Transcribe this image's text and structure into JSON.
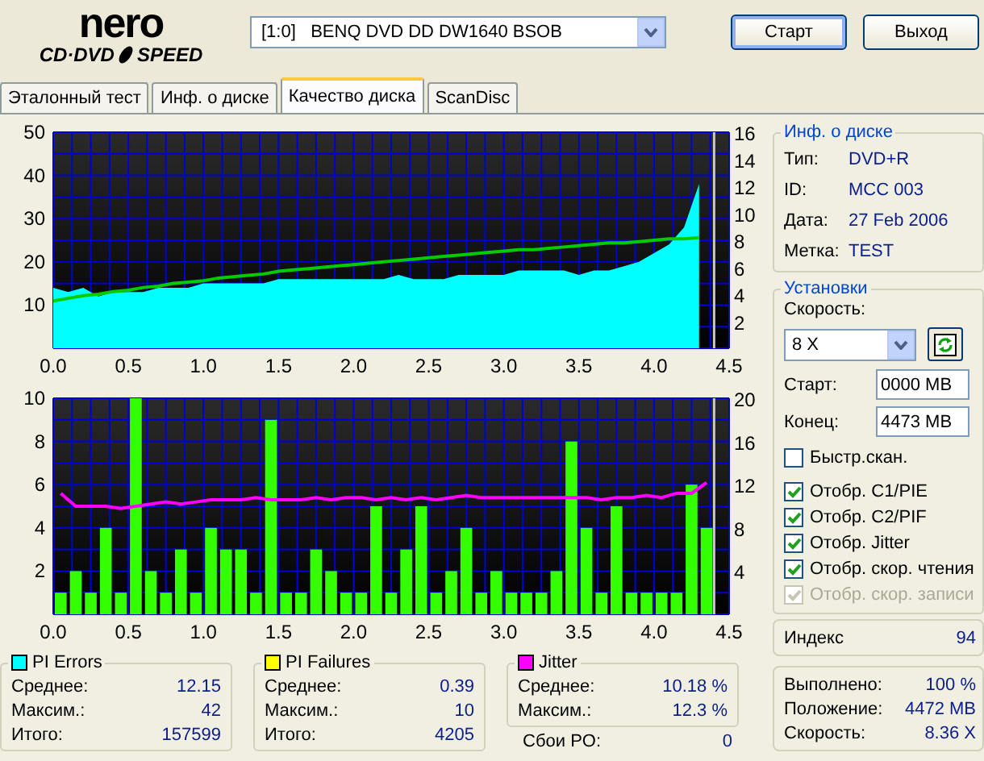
{
  "logo": {
    "top": "nero",
    "left": "CD·DVD",
    "right": "SPEED"
  },
  "drive": {
    "value": "[1:0]   BENQ DVD DD DW1640 BSOB"
  },
  "buttons": [
    {
      "label": "Старт",
      "default": true
    },
    {
      "label": "Выход",
      "default": false
    }
  ],
  "tabs": [
    {
      "label": "Эталонный тест",
      "selected": false
    },
    {
      "label": "Инф. о диске",
      "selected": false
    },
    {
      "label": "Качество диска",
      "selected": true
    },
    {
      "label": "ScanDisc",
      "selected": false
    }
  ],
  "charts": [
    {
      "chart_data": {
        "type": "area",
        "grid": true,
        "xlim": [
          0,
          4.5
        ],
        "ylim": [
          0,
          50
        ],
        "y2lim": [
          0,
          16
        ],
        "ref_lines": [
          {
            "axis": "x",
            "value": 4.4,
            "color": "#c8c8c8"
          }
        ],
        "xticks": [
          {
            "value": 0,
            "label": "0.0"
          },
          {
            "value": 0.5,
            "label": "0.5"
          },
          {
            "value": 1,
            "label": "1.0"
          },
          {
            "value": 1.5,
            "label": "1.5"
          },
          {
            "value": 2,
            "label": "2.0"
          },
          {
            "value": 2.5,
            "label": "2.5"
          },
          {
            "value": 3,
            "label": "3.0"
          },
          {
            "value": 3.5,
            "label": "3.5"
          },
          {
            "value": 4,
            "label": "4.0"
          },
          {
            "value": 4.5,
            "label": "4.5"
          }
        ],
        "yticks": [
          10,
          20,
          30,
          40,
          50
        ],
        "y2ticks": [
          2,
          4,
          6,
          8,
          10,
          12,
          14,
          16
        ],
        "x": [
          0,
          0.1,
          0.2,
          0.3,
          0.4,
          0.5,
          0.6,
          0.7,
          0.8,
          0.9,
          1,
          1.1,
          1.2,
          1.3,
          1.4,
          1.5,
          1.6,
          1.7,
          1.8,
          1.9,
          2,
          2.1,
          2.2,
          2.3,
          2.4,
          2.5,
          2.6,
          2.7,
          2.8,
          2.9,
          3,
          3.1,
          3.2,
          3.3,
          3.4,
          3.5,
          3.6,
          3.7,
          3.8,
          3.9,
          4,
          4.1,
          4.2,
          4.3
        ],
        "series": [
          {
            "color": "#00ffff",
            "values": [
              14,
              13,
              14,
              12,
              13,
              13,
              13,
              14,
              14,
              14,
              15,
              15,
              15,
              15,
              15,
              16,
              16,
              16,
              16,
              16,
              16,
              16,
              16,
              17,
              16,
              16,
              16,
              17,
              17,
              17,
              17,
              18,
              18,
              18,
              18,
              17,
              18,
              18,
              19,
              20,
              22,
              24,
              28,
              38
            ]
          },
          {
            "type": "line",
            "axis": "y2",
            "color": "#00cc00",
            "values": [
              3.5,
              3.7,
              3.9,
              4.0,
              4.2,
              4.3,
              4.5,
              4.6,
              4.8,
              4.9,
              5.0,
              5.2,
              5.3,
              5.4,
              5.5,
              5.7,
              5.8,
              5.9,
              6.0,
              6.1,
              6.2,
              6.3,
              6.4,
              6.5,
              6.6,
              6.7,
              6.8,
              6.9,
              7.0,
              7.1,
              7.2,
              7.3,
              7.3,
              7.4,
              7.5,
              7.6,
              7.7,
              7.8,
              7.8,
              7.9,
              8.0,
              8.1,
              8.1,
              8.2
            ]
          }
        ]
      }
    },
    {
      "chart_data": {
        "type": "bar",
        "grid": true,
        "xlim": [
          0,
          4.5
        ],
        "ylim": [
          0,
          10
        ],
        "y2lim": [
          0,
          20
        ],
        "ref_lines": [
          {
            "axis": "x",
            "value": 4.4,
            "color": "#c8c8c8"
          }
        ],
        "xticks": [
          {
            "value": 0,
            "label": "0.0"
          },
          {
            "value": 0.5,
            "label": "0.5"
          },
          {
            "value": 1,
            "label": "1.0"
          },
          {
            "value": 1.5,
            "label": "1.5"
          },
          {
            "value": 2,
            "label": "2.0"
          },
          {
            "value": 2.5,
            "label": "2.5"
          },
          {
            "value": 3,
            "label": "3.0"
          },
          {
            "value": 3.5,
            "label": "3.5"
          },
          {
            "value": 4,
            "label": "4.0"
          },
          {
            "value": 4.5,
            "label": "4.5"
          }
        ],
        "yticks": [
          2,
          4,
          6,
          8,
          10
        ],
        "y2ticks": [
          4,
          8,
          12,
          16,
          20
        ],
        "x": [
          0.05,
          0.15,
          0.25,
          0.35,
          0.45,
          0.55,
          0.65,
          0.75,
          0.85,
          0.95,
          1.05,
          1.15,
          1.25,
          1.35,
          1.45,
          1.55,
          1.65,
          1.75,
          1.85,
          1.95,
          2.05,
          2.15,
          2.25,
          2.35,
          2.45,
          2.55,
          2.65,
          2.75,
          2.85,
          2.95,
          3.05,
          3.15,
          3.25,
          3.35,
          3.45,
          3.55,
          3.65,
          3.75,
          3.85,
          3.95,
          4.05,
          4.15,
          4.25,
          4.35
        ],
        "series": [
          {
            "color": "#33ff00",
            "values": [
              1,
              2,
              1,
              4,
              1,
              10,
              2,
              1,
              3,
              1,
              4,
              3,
              3,
              1,
              9,
              1,
              1,
              3,
              2,
              1,
              1,
              5,
              1,
              3,
              5,
              1,
              2,
              4,
              1,
              2,
              1,
              1,
              1,
              2,
              8,
              4,
              1,
              5,
              1,
              1,
              1,
              1,
              6,
              4
            ]
          },
          {
            "type": "line",
            "axis": "y2",
            "color": "#ff00ff",
            "values": [
              11.2,
              10,
              10,
              10,
              9.8,
              10,
              10.2,
              10.4,
              10.2,
              10.4,
              10.6,
              10.6,
              10.6,
              10.8,
              10.6,
              10.6,
              10.6,
              10.8,
              10.6,
              10.8,
              10.8,
              10.6,
              10.8,
              10.6,
              10.8,
              10.6,
              10.8,
              11,
              10.8,
              10.8,
              10.8,
              10.8,
              10.8,
              10.8,
              10.8,
              10.8,
              10.6,
              10.8,
              10.8,
              11,
              10.8,
              11.2,
              11.2,
              12.2
            ]
          }
        ]
      }
    }
  ],
  "stats": [
    {
      "title": "PI Errors",
      "color": "#00ffff",
      "rows": [
        {
          "label": "Среднее:",
          "value": "12.15"
        },
        {
          "label": "Максим.:",
          "value": "42"
        },
        {
          "label": "Итого:",
          "value": "157599"
        }
      ]
    },
    {
      "title": "PI Failures",
      "color": "#ffff00",
      "rows": [
        {
          "label": "Среднее:",
          "value": "0.39"
        },
        {
          "label": "Максим.:",
          "value": "10"
        },
        {
          "label": "Итого:",
          "value": "4205"
        }
      ]
    },
    {
      "title": "Jitter",
      "color": "#ff00ff",
      "rows": [
        {
          "label": "Среднее:",
          "value": "10.18 %"
        },
        {
          "label": "Максим.:",
          "value": "12.3 %"
        }
      ]
    }
  ],
  "po_failures": {
    "label": "Сбои PO:",
    "value": "0"
  },
  "disc_info": {
    "title": "Инф. о диске",
    "rows": [
      {
        "label": "Тип:",
        "value": "DVD+R"
      },
      {
        "label": "ID:",
        "value": "MCC 003"
      },
      {
        "label": "Дата:",
        "value": "27 Feb 2006"
      },
      {
        "label": "Метка:",
        "value": "TEST"
      }
    ]
  },
  "settings": {
    "title": "Установки",
    "speed_label": "Скорость:",
    "speed_value": "8 X",
    "fields": [
      {
        "label": "Старт:",
        "value": "0000 MB"
      },
      {
        "label": "Конец:",
        "value": "4473 MB"
      }
    ],
    "checkboxes": [
      {
        "label": "Быстр.скан.",
        "checked": false,
        "disabled": false
      },
      {
        "label": "Отобр. C1/PIE",
        "checked": true,
        "disabled": false
      },
      {
        "label": "Отобр. C2/PIF",
        "checked": true,
        "disabled": false
      },
      {
        "label": "Отобр. Jitter",
        "checked": true,
        "disabled": false
      },
      {
        "label": "Отобр. скор. чтения",
        "checked": true,
        "disabled": false
      },
      {
        "label": "Отобр. скор. записи",
        "checked": true,
        "disabled": true
      }
    ]
  },
  "index": {
    "label": "Индекс",
    "value": "94"
  },
  "progress": [
    {
      "label": "Выполнено:",
      "value": "100 %"
    },
    {
      "label": "Положение:",
      "value": "4472 MB"
    },
    {
      "label": "Скорость:",
      "value": "8.36 X"
    }
  ]
}
